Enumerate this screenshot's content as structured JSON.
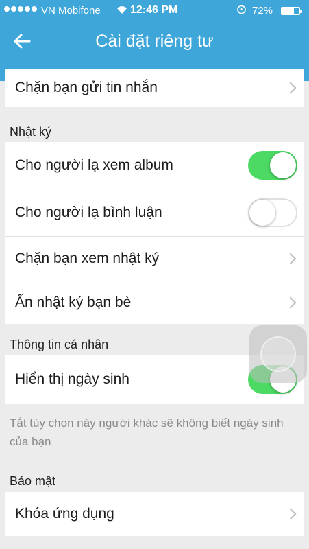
{
  "status_bar": {
    "carrier": "VN Mobifone",
    "time": "12:46 PM",
    "battery_percent": "72%",
    "battery_level": 0.72,
    "icons": [
      "signal-dots-icon",
      "wifi-icon",
      "alarm-icon",
      "battery-icon"
    ]
  },
  "header": {
    "title": "Cài đặt riêng tư",
    "back_icon": "arrow-left-icon"
  },
  "colors": {
    "header_bg": "#3fa6da",
    "toggle_on": "#4cd964",
    "background": "#ececec"
  },
  "top_group": {
    "items": [
      {
        "label": "Chặn bạn gửi tin nhắn",
        "type": "link"
      }
    ]
  },
  "diary": {
    "section_title": "Nhật ký",
    "items": [
      {
        "label": "Cho người lạ xem album",
        "type": "toggle",
        "on": true
      },
      {
        "label": "Cho người lạ bình luận",
        "type": "toggle",
        "on": false
      },
      {
        "label": "Chặn bạn xem nhật ký",
        "type": "link"
      },
      {
        "label": "Ẩn nhật ký bạn bè",
        "type": "link"
      }
    ]
  },
  "personal": {
    "section_title": "Thông tin cá nhân",
    "items": [
      {
        "label": "Hiển thị ngày sinh",
        "type": "toggle",
        "on": true
      }
    ],
    "note": "Tắt tùy chọn này người khác sẽ không biết ngày sinh của bạn"
  },
  "security": {
    "section_title": "Bảo mật",
    "items": [
      {
        "label": "Khóa ứng dụng",
        "type": "link"
      }
    ]
  }
}
